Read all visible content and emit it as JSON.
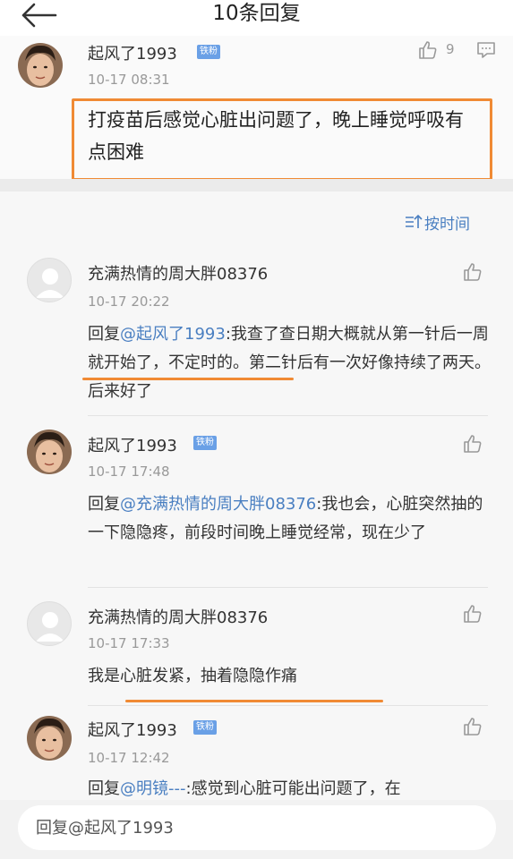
{
  "header": {
    "title": "10条回复"
  },
  "main_post": {
    "user": "起风了1993",
    "badge": "铁粉",
    "time": "10-17 08:31",
    "likes": "9",
    "content": "打疫苗后感觉心脏出问题了，晚上睡觉呼吸有点困难"
  },
  "sort": {
    "label": "按时间"
  },
  "replies": [
    {
      "user": "充满热情的周大胖08376",
      "time": "10-17 20:22",
      "prefix": "回复",
      "mention": "@起风了1993",
      "text": ":我查了查日期大概就从第一针后一周就开始了，不定时的。第二针后有一次好像持续了两天。后来好了"
    },
    {
      "user": "起风了1993",
      "badge": "铁粉",
      "time": "10-17 17:48",
      "prefix": "回复",
      "mention": "@充满热情的周大胖08376",
      "text": ":我也会，心脏突然抽的一下隐隐疼，前段时间晚上睡觉经常，现在少了"
    },
    {
      "user": "充满热情的周大胖08376",
      "time": "10-17 17:33",
      "text": "我是心脏发紧，抽着隐隐作痛"
    },
    {
      "user": "起风了1993",
      "badge": "铁粉",
      "time": "10-17 12:42",
      "prefix": "回复",
      "mention": "@明镜---",
      "text": ":感觉到心脏可能出问题了，在"
    }
  ],
  "reply_bar": {
    "placeholder": "回复@起风了1993"
  },
  "colors": {
    "accent": "#4a7fc1",
    "highlight": "#f08a34",
    "badge": "#6aa0e6"
  }
}
